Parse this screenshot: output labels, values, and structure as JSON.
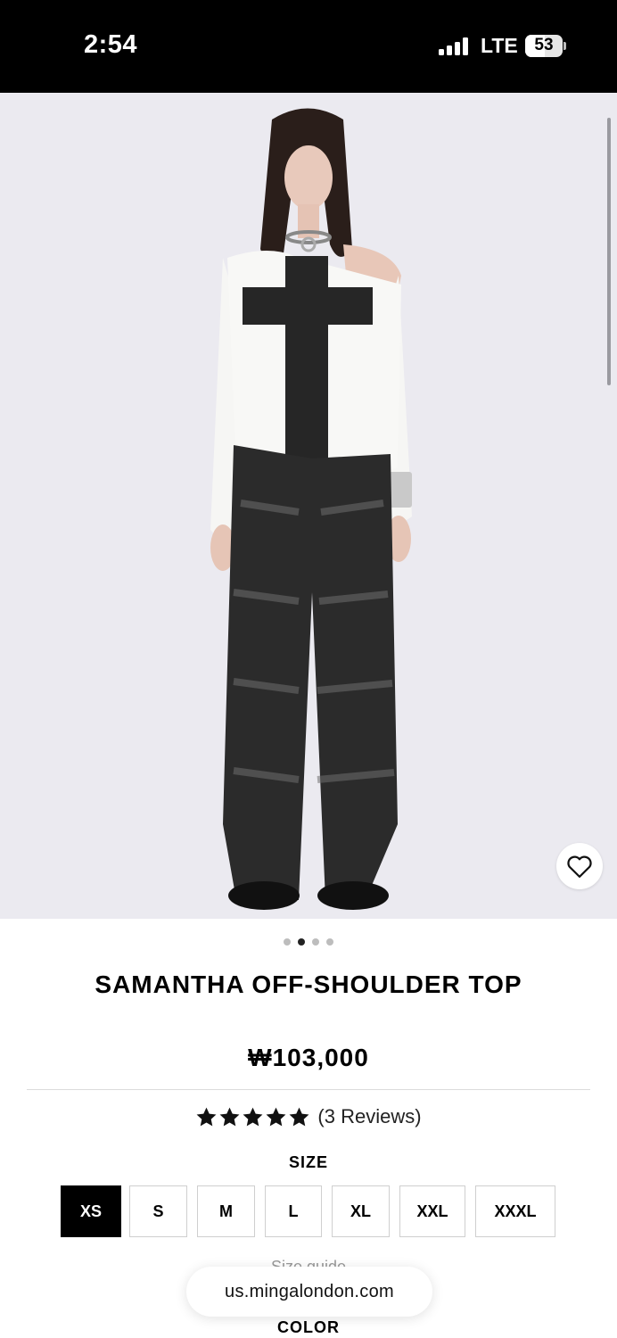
{
  "status_bar": {
    "time": "2:54",
    "network": "LTE",
    "battery": "53",
    "battery_level": 0.53
  },
  "gallery": {
    "image_count": 4,
    "active_index": 1,
    "wishlist_icon": "heart-icon"
  },
  "product": {
    "title": "SAMANTHA OFF-SHOULDER TOP",
    "price": "₩103,000",
    "rating": 5,
    "reviews_label": "(3 Reviews)"
  },
  "size": {
    "label": "SIZE",
    "options": [
      "XS",
      "S",
      "M",
      "L",
      "XL",
      "XXL",
      "XXXL"
    ],
    "selected": "XS",
    "guide_label": "Size guide"
  },
  "browser": {
    "url": "us.mingalondon.com"
  },
  "color": {
    "label": "COLOR"
  },
  "colors": {
    "page_bg": "#ffffff",
    "image_bg": "#ebeaf0",
    "selected_size_bg": "#000000"
  }
}
